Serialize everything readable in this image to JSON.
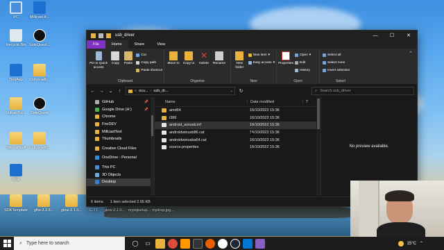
{
  "colors": {
    "file_tab": "#8130c4",
    "window_bg": "#191919",
    "ribbon_bg": "#2b2b2b",
    "folder": "#e8b23c",
    "taskbar": "#1c1c1c"
  },
  "desktop": {
    "icons": [
      {
        "label": "PC",
        "icon": "pc-icon"
      },
      {
        "label": "Millicast.fr...",
        "icon": "app-icon"
      },
      {
        "label": "Recycle Bin",
        "icon": "recycle-bin-icon"
      },
      {
        "label": "SideQuest...",
        "icon": "sidequest-icon"
      },
      {
        "label": "TestApp",
        "icon": "app-icon"
      },
      {
        "label": "oculus-adb...",
        "icon": "folder-icon"
      },
      {
        "label": "VulkanTut...",
        "icon": "folder-icon"
      },
      {
        "label": "SideQuest",
        "icon": "sidequest-icon"
      },
      {
        "label": "TutorialStuff",
        "icon": "folder-icon"
      },
      {
        "label": "oculus-adb...",
        "icon": "folder-icon"
      },
      {
        "label": "KFis",
        "icon": "app-icon"
      },
      {
        "label": "SDKTemplate",
        "icon": "folder-icon"
      },
      {
        "label": "glfw-3.3.8...",
        "icon": "folder-icon"
      },
      {
        "label": "glew-2.1.0...",
        "icon": "folder-icon"
      },
      {
        "label": "C.TT",
        "icon": "document-icon"
      },
      {
        "label": "glew-2.1.0...",
        "icon": "folder-icon"
      },
      {
        "label": "mysqlsetup...",
        "icon": "document-icon"
      },
      {
        "label": "mydrop.jpg...",
        "icon": "document-icon"
      }
    ]
  },
  "window": {
    "title": "usb_driver",
    "controls": {
      "minimize": "—",
      "maximize": "☐",
      "close": "✕"
    },
    "menu": {
      "file": "File",
      "home": "Home",
      "share": "Share",
      "view": "View"
    },
    "ribbon": {
      "clipboard": {
        "label": "Clipboard",
        "pin": "Pin to Quick access",
        "copy": "Copy",
        "paste": "Paste",
        "cut": "Cut",
        "copy_path": "Copy path",
        "paste_shortcut": "Paste shortcut"
      },
      "organise": {
        "label": "Organise",
        "move_to": "Move to",
        "copy_to": "Copy to",
        "delete": "Delete",
        "rename": "Rename"
      },
      "new": {
        "label": "New",
        "new_folder": "New folder",
        "new_item": "New item",
        "easy_access": "Easy access"
      },
      "open": {
        "label": "Open",
        "properties": "Properties",
        "open": "Open",
        "edit": "Edit",
        "history": "History"
      },
      "select": {
        "label": "Select",
        "select_all": "Select all",
        "select_none": "Select none",
        "invert": "Invert selection"
      }
    },
    "address": {
      "back": "←",
      "forward": "→",
      "recent": "⌄",
      "up": "↑",
      "crumbs": [
        "ocu...",
        "usb_dr..."
      ],
      "search_placeholder": "Search usb_driver"
    },
    "nav": [
      {
        "label": "GitHub",
        "pinned": true
      },
      {
        "label": "Google Drive (H:)",
        "pinned": true
      },
      {
        "label": "Chrome",
        "pinned": false
      },
      {
        "label": "FireDEV",
        "pinned": false
      },
      {
        "label": "MillcastTest",
        "pinned": false
      },
      {
        "label": "Thumbnails",
        "pinned": false
      },
      {
        "label": "Creative Cloud Files",
        "pinned": false
      },
      {
        "label": "OneDrive - Personal",
        "pinned": false
      },
      {
        "label": "This PC",
        "pinned": false
      },
      {
        "label": "3D Objects",
        "pinned": false
      },
      {
        "label": "Desktop",
        "pinned": false
      }
    ],
    "columns": {
      "name": "Name",
      "date": "Date modified",
      "type": "T"
    },
    "files": [
      {
        "name": "amd64",
        "date": "16/10/2022 15:36",
        "kind": "folder"
      },
      {
        "name": "i386",
        "date": "16/10/2022 15:36",
        "kind": "folder"
      },
      {
        "name": "android_winusb.inf",
        "date": "16/10/2022 15:36",
        "kind": "file"
      },
      {
        "name": "androidwinusb86.cat",
        "date": "16/10/2022 15:36",
        "kind": "file"
      },
      {
        "name": "androidwinusba64.cat",
        "date": "16/10/2022 15:36",
        "kind": "file"
      },
      {
        "name": "source.properties",
        "date": "16/10/2022 15:36",
        "kind": "file"
      }
    ],
    "selected_file_index": 2,
    "preview_text": "No preview available.",
    "status": {
      "items": "6 items",
      "selected": "1 item selected  2.65 KB"
    }
  },
  "taskbar": {
    "search_placeholder": "Type here to search",
    "weather": "15°C"
  }
}
